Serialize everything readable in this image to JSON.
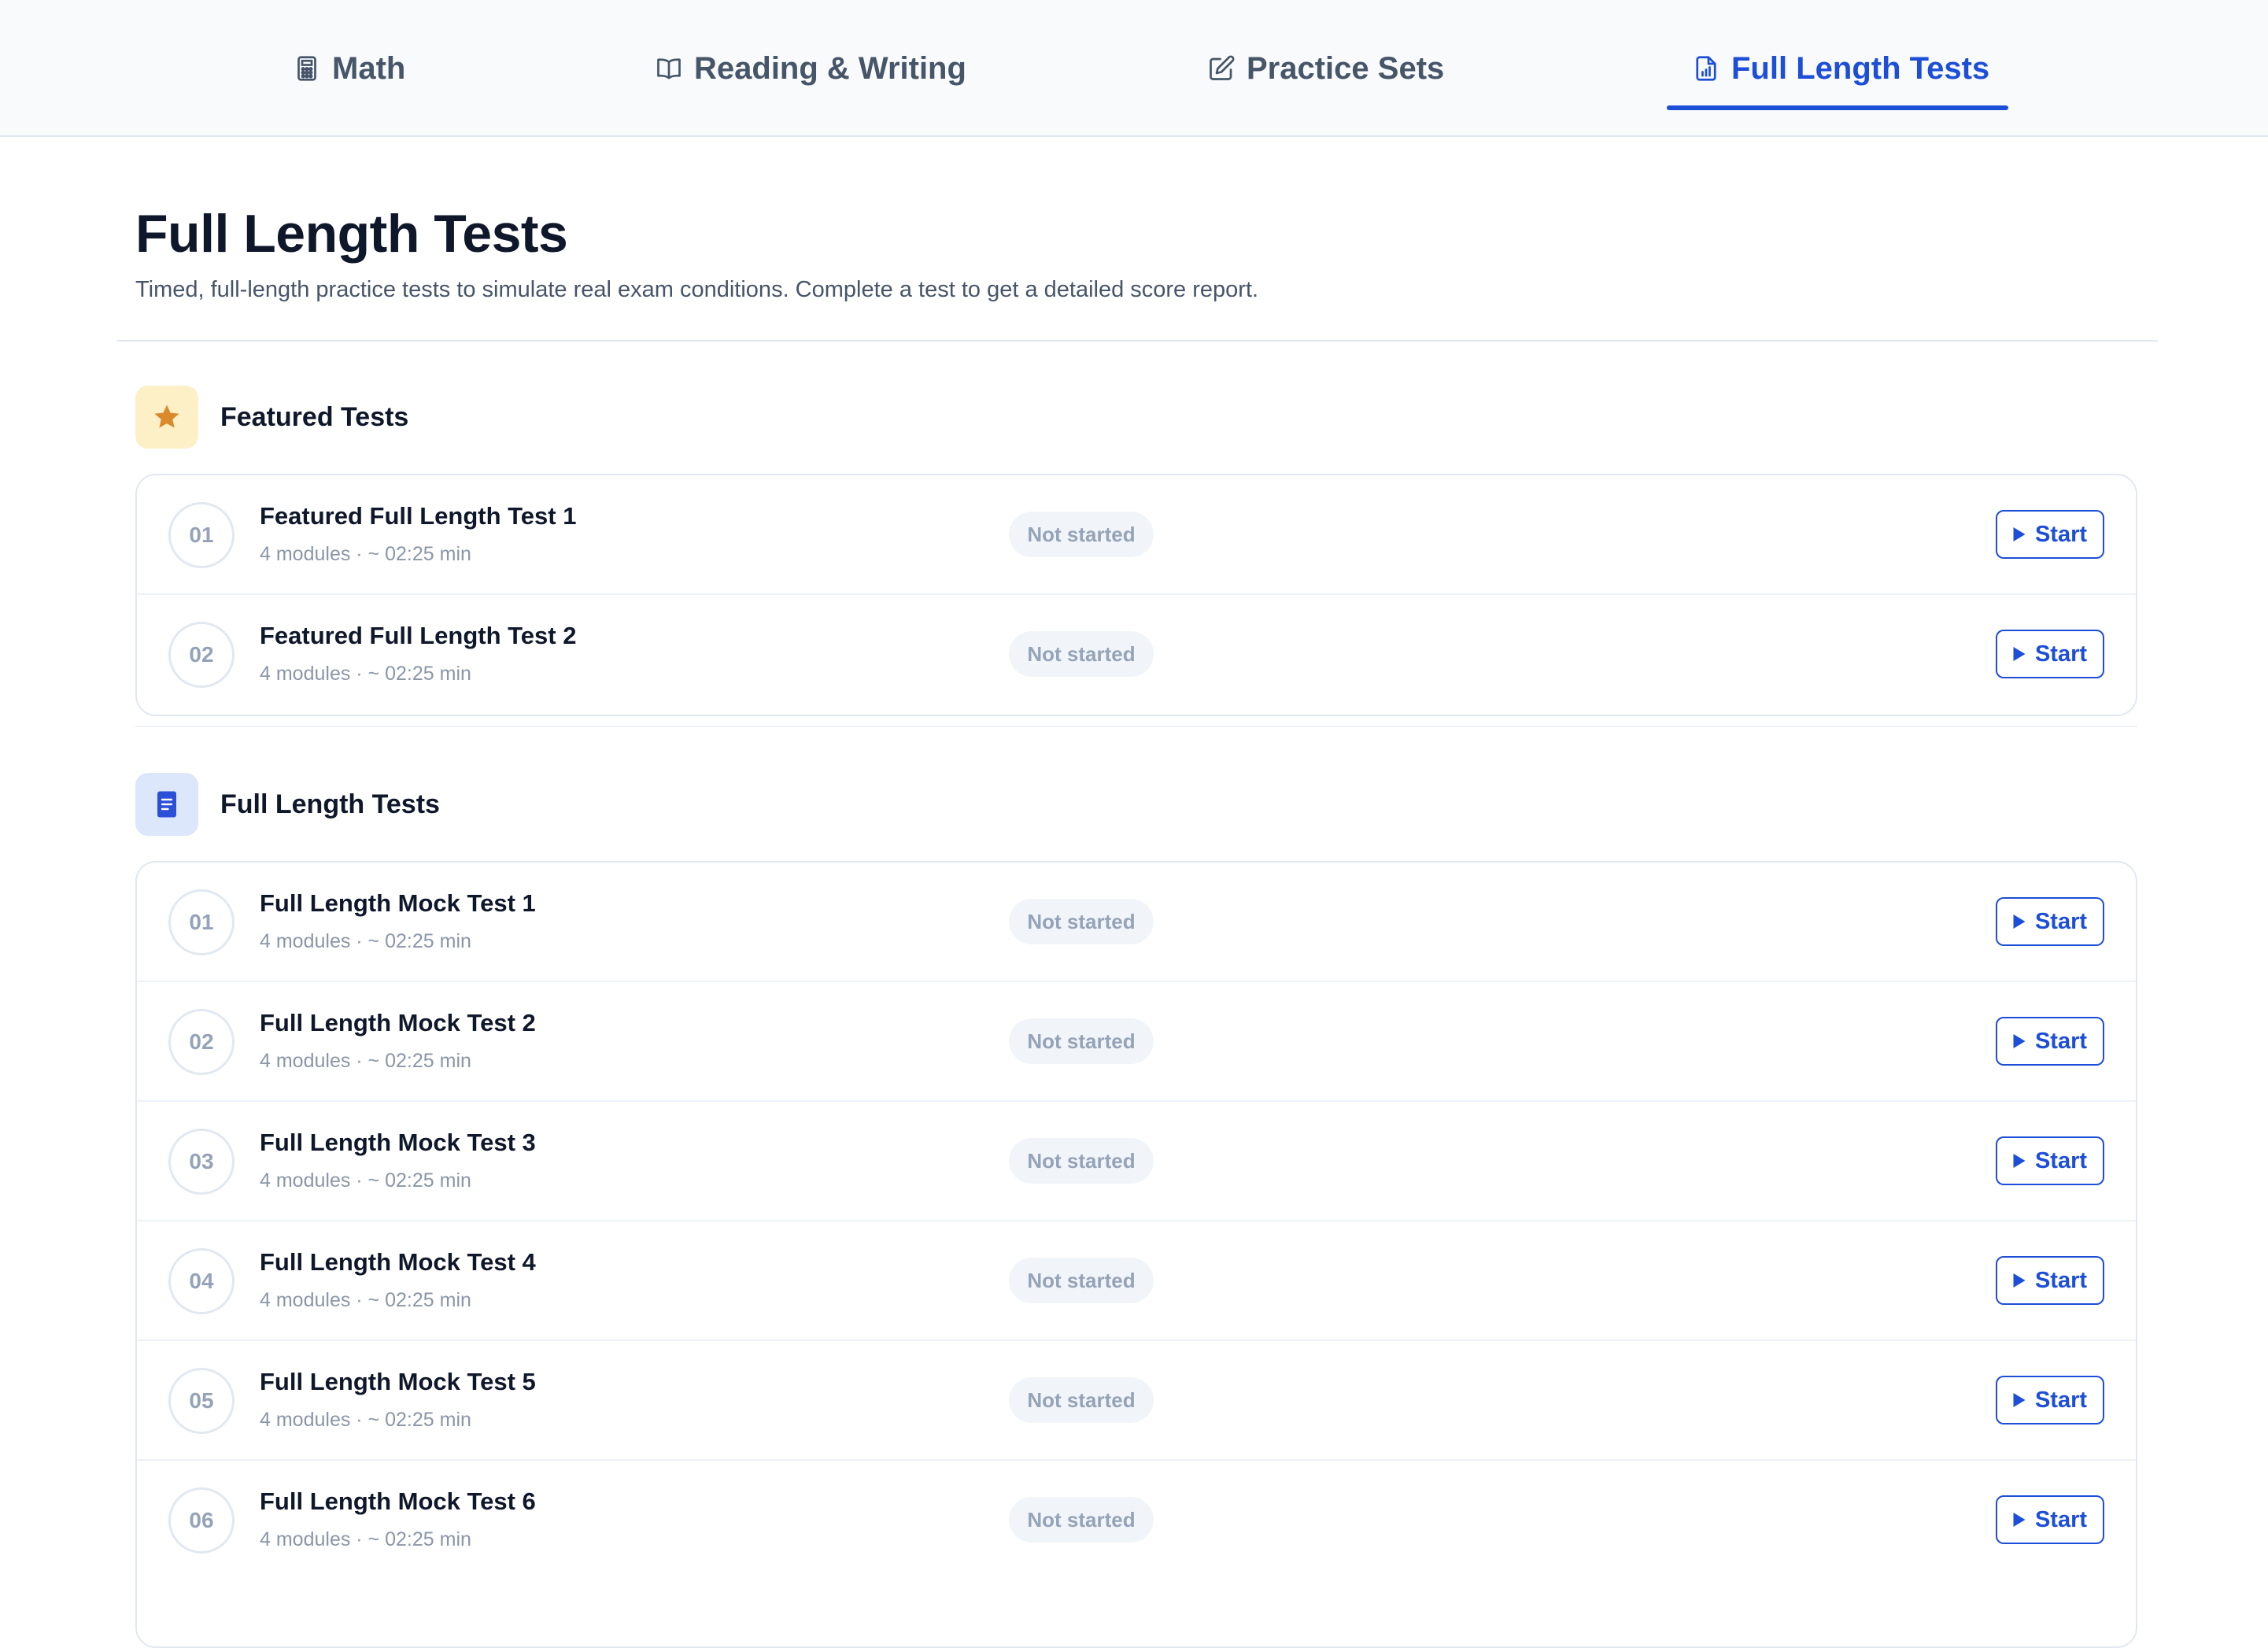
{
  "nav": {
    "tabs": [
      {
        "label": "Math",
        "icon": "calculator-icon"
      },
      {
        "label": "Reading & Writing",
        "icon": "book-open-icon"
      },
      {
        "label": "Practice Sets",
        "icon": "pencil-square-icon"
      },
      {
        "label": "Full Length Tests",
        "icon": "document-chart-icon",
        "active": true
      }
    ]
  },
  "header": {
    "title": "Full Length Tests",
    "subtitle": "Timed, full-length practice tests to simulate real exam conditions. Complete a test to get a detailed score report."
  },
  "colors": {
    "accent": "#1d4ed8",
    "star": "#d98a2b",
    "star_bg": "#fdf0c7",
    "doc_bg": "#dde7fb"
  },
  "featured": {
    "title": "Featured Tests",
    "icon": "star-icon",
    "items": [
      {
        "num": "01",
        "title": "Featured Full Length Test 1",
        "meta": "4 modules · ~ 02:25 min",
        "status": "Not started",
        "action": "Start"
      },
      {
        "num": "02",
        "title": "Featured Full Length Test 2",
        "meta": "4 modules · ~ 02:25 min",
        "status": "Not started",
        "action": "Start"
      }
    ]
  },
  "full": {
    "title": "Full Length Tests",
    "icon": "document-icon",
    "items": [
      {
        "num": "01",
        "title": "Full Length Mock Test 1",
        "meta": "4 modules · ~ 02:25 min",
        "status": "Not started",
        "action": "Start"
      },
      {
        "num": "02",
        "title": "Full Length Mock Test 2",
        "meta": "4 modules · ~ 02:25 min",
        "status": "Not started",
        "action": "Start"
      },
      {
        "num": "03",
        "title": "Full Length Mock Test 3",
        "meta": "4 modules · ~ 02:25 min",
        "status": "Not started",
        "action": "Start"
      },
      {
        "num": "04",
        "title": "Full Length Mock Test 4",
        "meta": "4 modules · ~ 02:25 min",
        "status": "Not started",
        "action": "Start"
      },
      {
        "num": "05",
        "title": "Full Length Mock Test 5",
        "meta": "4 modules · ~ 02:25 min",
        "status": "Not started",
        "action": "Start"
      },
      {
        "num": "06",
        "title": "Full Length Mock Test 6",
        "meta": "4 modules · ~ 02:25 min",
        "status": "Not started",
        "action": "Start"
      }
    ]
  }
}
